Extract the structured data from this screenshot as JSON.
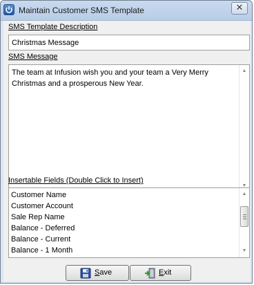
{
  "window": {
    "title": "Maintain Customer SMS Template",
    "close_glyph": "✕"
  },
  "sms_template_description": {
    "label": "SMS Template Description",
    "value": "Christmas Message"
  },
  "sms_message": {
    "label": "SMS Message",
    "value": "The team at Infusion wish you and your team a Very Merry\nChristmas and a prosperous New Year."
  },
  "insertable_fields": {
    "label": "Insertable Fields (Double Click to Insert)",
    "items": [
      "Customer Name",
      "Customer Account",
      "Sale Rep Name",
      "Balance - Deferred",
      "Balance - Current",
      "Balance - 1 Month"
    ]
  },
  "buttons": {
    "save": {
      "accel": "S",
      "rest": "ave",
      "icon": "floppy-disk-icon"
    },
    "exit": {
      "accel": "E",
      "rest": "xit",
      "icon": "exit-door-icon"
    }
  },
  "icons": {
    "app": "power-icon"
  }
}
